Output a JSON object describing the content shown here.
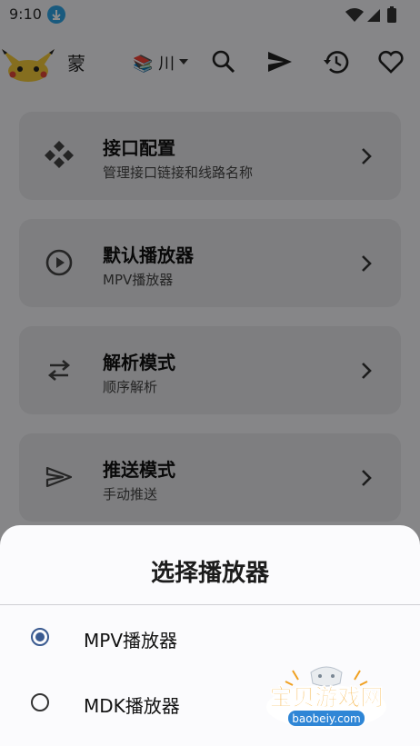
{
  "status_bar": {
    "time": "9:10"
  },
  "app_bar": {
    "title": "蒙",
    "source_label": "📚 川",
    "icons": [
      "search-icon",
      "send-icon",
      "history-icon",
      "heart-icon"
    ]
  },
  "settings": [
    {
      "title": "接口配置",
      "subtitle": "管理接口链接和线路名称",
      "icon": "diamond-grid-icon"
    },
    {
      "title": "默认播放器",
      "subtitle": "MPV播放器",
      "icon": "play-circle-icon"
    },
    {
      "title": "解析模式",
      "subtitle": "顺序解析",
      "icon": "swap-arrows-icon"
    },
    {
      "title": "推送模式",
      "subtitle": "手动推送",
      "icon": "send-icon"
    }
  ],
  "sheet": {
    "title": "选择播放器",
    "options": [
      {
        "label": "MPV播放器",
        "selected": true
      },
      {
        "label": "MDK播放器",
        "selected": false
      }
    ]
  },
  "watermark": {
    "text": "宝贝游戏网",
    "url_text": "baobeiy.com"
  }
}
